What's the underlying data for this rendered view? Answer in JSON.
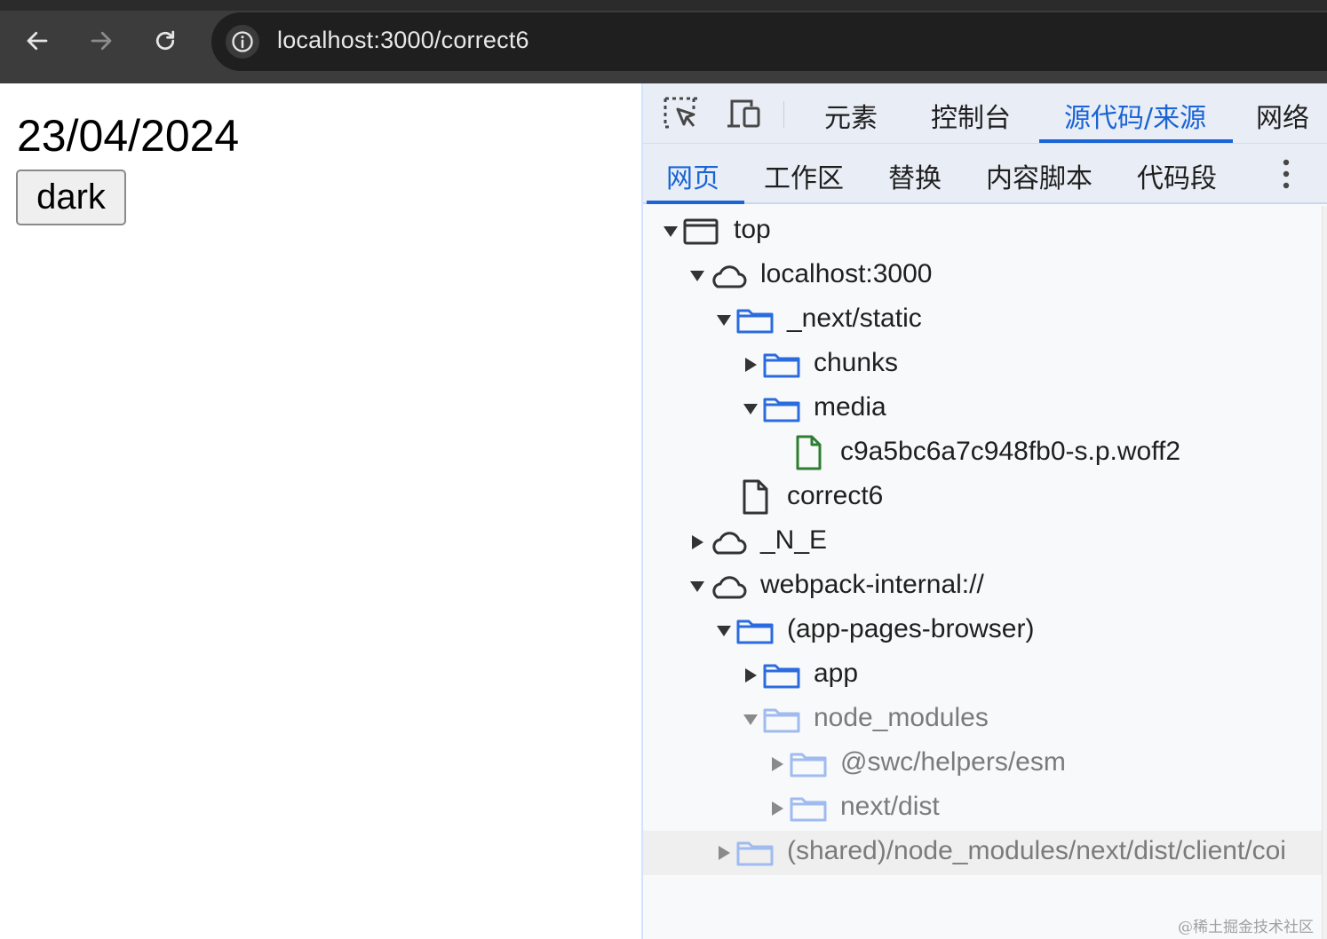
{
  "browser": {
    "url": "localhost:3000/correct6"
  },
  "page": {
    "date_text": "23/04/2024",
    "button_label": "dark"
  },
  "devtools": {
    "main_tabs": [
      "元素",
      "控制台",
      "源代码/来源",
      "网络"
    ],
    "active_main_tab": "源代码/来源",
    "sub_tabs": [
      "网页",
      "工作区",
      "替换",
      "内容脚本",
      "代码段"
    ],
    "active_sub_tab": "网页",
    "tree": [
      {
        "label": "top",
        "icon": "frame-icon",
        "expanded": true
      },
      {
        "label": "localhost:3000",
        "icon": "cloud-icon",
        "expanded": true
      },
      {
        "label": "_next/static",
        "icon": "folder-icon",
        "expanded": true
      },
      {
        "label": "chunks",
        "icon": "folder-icon",
        "expanded": false
      },
      {
        "label": "media",
        "icon": "folder-icon",
        "expanded": true
      },
      {
        "label": "c9a5bc6a7c948fb0-s.p.woff2",
        "icon": "font-file-icon"
      },
      {
        "label": "correct6",
        "icon": "file-icon"
      },
      {
        "label": "_N_E",
        "icon": "cloud-icon",
        "expanded": false
      },
      {
        "label": "webpack-internal://",
        "icon": "cloud-icon",
        "expanded": true
      },
      {
        "label": "(app-pages-browser)",
        "icon": "folder-icon",
        "expanded": true
      },
      {
        "label": "app",
        "icon": "folder-icon",
        "expanded": false
      },
      {
        "label": "node_modules",
        "icon": "folder-icon",
        "expanded": true,
        "dimmed": true
      },
      {
        "label": "@swc/helpers/esm",
        "icon": "folder-icon",
        "expanded": false,
        "dimmed": true
      },
      {
        "label": "next/dist",
        "icon": "folder-icon",
        "expanded": false,
        "dimmed": true
      },
      {
        "label": "(shared)/node_modules/next/dist/client/coi",
        "icon": "folder-icon",
        "expanded": false,
        "dimmed": true
      }
    ]
  },
  "watermark": "@稀土掘金技术社区",
  "colors": {
    "accent": "#1a64d6",
    "folder_blue": "#2a6be0",
    "font_file_green": "#2e7d32"
  }
}
